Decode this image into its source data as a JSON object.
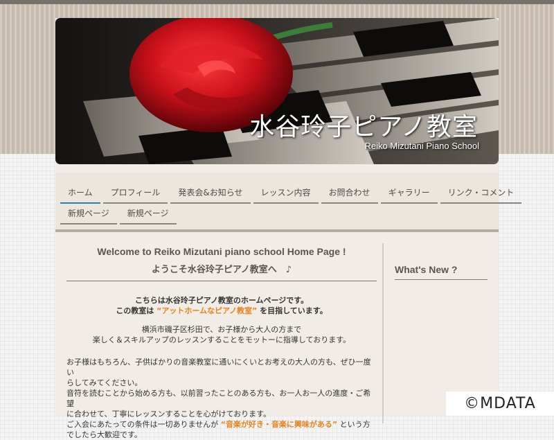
{
  "header": {
    "title": "水谷玲子ピアノ教室",
    "subtitle": "Reiko Mizutani Piano School",
    "image": "rose-on-piano-keys-image"
  },
  "nav": {
    "row1": [
      "ホーム",
      "プロフィール",
      "発表会&お知らせ",
      "レッスン内容",
      "お問合わせ",
      "ギャラリー",
      "リンク・コメント"
    ],
    "row2": [
      "新規ページ",
      "新規ページ"
    ],
    "active": "ホーム"
  },
  "main": {
    "welcome_en": "Welcome to Reiko Mizutani piano school Home Page !",
    "welcome_ja": "ようこそ水谷玲子ピアノ教室へ　♪",
    "intro_line1": "こちらは水谷玲子ピアノ教室のホームページです。",
    "intro_line2_pre": "この教室は",
    "intro_line2_highlight": "“アットホームなピアノ教室”",
    "intro_line2_post": "を目指しています。",
    "address_line1": "横浜市磯子区杉田で、お子様から大人の方まで",
    "address_line2": "楽しく＆スキルアップのレッスンすることをモットーに指導しております。",
    "body_p1a": "お子様はもちろん、子供ばかりの音楽教室に通いにくいとお考えの大人の方も、ぜひ一度い",
    "body_p1b": "らしてみてください。",
    "body_p2a": "音符を読むことから始める方も、以前習ったことのある方も、お一人お一人の進度・ご希望",
    "body_p2b": "に合わせて、丁寧にレッスンすることを心がけております。",
    "body_p3_pre": "ご入会にあたっての条件は一切ありませんが",
    "body_p3_highlight": "“音楽が好き・音楽に興味がある”",
    "body_p3_post": "という方",
    "body_p4": "でしたら大歓迎です。"
  },
  "sidebar": {
    "whats_new": "What's New ?"
  },
  "watermark": "©MDATA",
  "colors": {
    "accent": "#e8821c",
    "nav_active": "#2f7fa8",
    "rose": "#c8101a"
  }
}
